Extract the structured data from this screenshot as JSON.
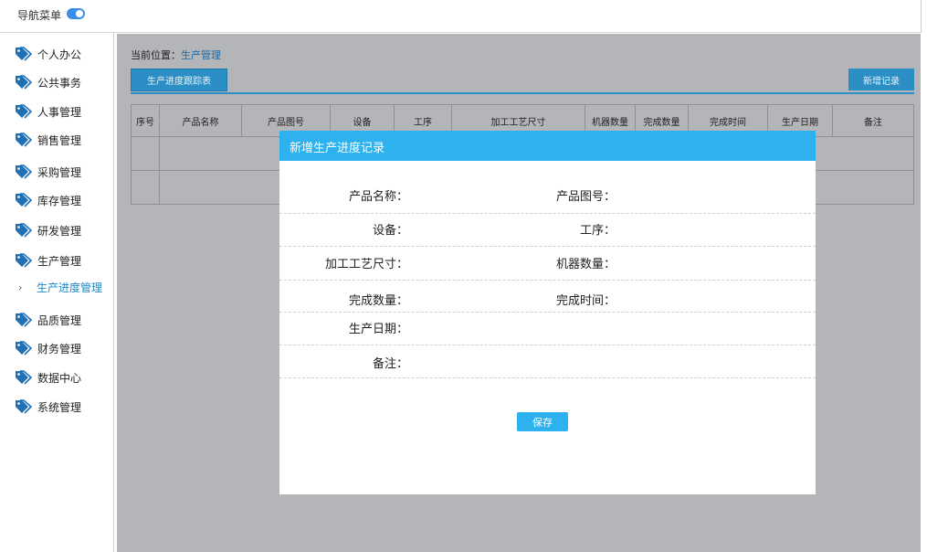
{
  "topbar": {
    "nav_title": "导航菜单",
    "toggle_on": true
  },
  "sidebar": {
    "items": [
      {
        "label": "个人办公"
      },
      {
        "label": "公共事务"
      },
      {
        "label": "人事管理"
      },
      {
        "label": "销售管理"
      },
      {
        "label": "采购管理"
      },
      {
        "label": "库存管理"
      },
      {
        "label": "研发管理"
      },
      {
        "label": "生产管理"
      },
      {
        "label": "品质管理"
      },
      {
        "label": "财务管理"
      },
      {
        "label": "数据中心"
      },
      {
        "label": "系统管理"
      }
    ],
    "submenu": {
      "label": "生产进度管理"
    }
  },
  "main": {
    "breadcrumb_prefix": "当前位置：",
    "breadcrumb_current": "生产管理",
    "tab_label": "生产进度跟踪表",
    "add_button": "新增记录",
    "table_headers": [
      "序号",
      "产品名称",
      "产品图号",
      "设备",
      "工序",
      "加工工艺尺寸",
      "机器数量",
      "完成数量",
      "完成时间",
      "生产日期",
      "备注"
    ]
  },
  "modal": {
    "title": "新增生产进度记录",
    "fields": {
      "product_name": "产品名称：",
      "product_drawing": "产品图号：",
      "equipment": "设备：",
      "process": "工序：",
      "machining_size": "加工工艺尺寸：",
      "machine_count": "机器数量：",
      "completed_count": "完成数量：",
      "completed_time": "完成时间：",
      "production_date": "生产日期：",
      "remarks": "备注："
    },
    "save_button": "保存"
  },
  "colors": {
    "accent": "#2eb2ef",
    "tab": "#2b8ec4",
    "overlay": "#b3b5b8",
    "icon": "#1f6fb5"
  }
}
